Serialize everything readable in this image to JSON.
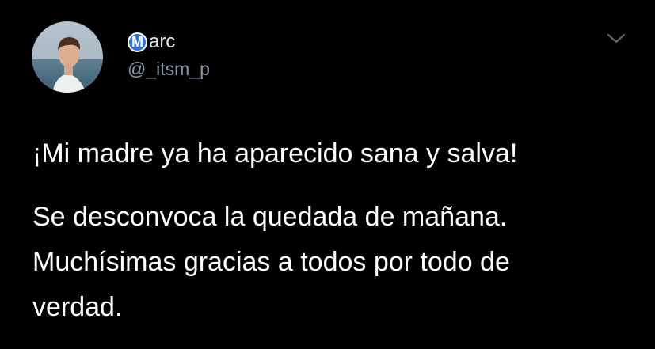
{
  "tweet": {
    "author": {
      "badge_letter": "M",
      "display_name": "arc",
      "handle": "@_itsm_p",
      "badge_color": "#2f6fd8"
    },
    "menu_icon": "chevron-down-icon",
    "text_line1": "¡Mi madre ya ha aparecido sana y salva!",
    "text_para2": "Se desconvoca la quedada de mañana.\nMuchísimas gracias a todos por todo de\nverdad."
  },
  "colors": {
    "background": "#000000",
    "primary_text": "#ffffff",
    "secondary_text": "#8b98a5"
  }
}
